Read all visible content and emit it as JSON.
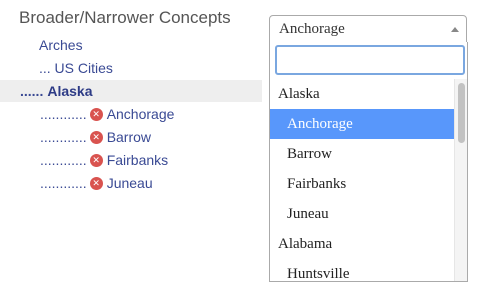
{
  "heading": "Broader/Narrower Concepts",
  "tree": {
    "root": "Arches",
    "parent": "... US Cities",
    "selected_prefix": "......",
    "selected": "Alaska",
    "child_prefix": "............",
    "children": [
      "Anchorage",
      "Barrow",
      "Fairbanks",
      "Juneau"
    ]
  },
  "select": {
    "value": "Anchorage",
    "search_value": "",
    "options": [
      {
        "label": "Alaska",
        "kind": "group"
      },
      {
        "label": "Anchorage",
        "kind": "child",
        "highlighted": true
      },
      {
        "label": "Barrow",
        "kind": "child"
      },
      {
        "label": "Fairbanks",
        "kind": "child"
      },
      {
        "label": "Juneau",
        "kind": "child"
      },
      {
        "label": "Alabama",
        "kind": "group"
      },
      {
        "label": "Huntsville",
        "kind": "child"
      }
    ]
  },
  "colors": {
    "link": "#3a4a94",
    "remove_icon": "#d9534f",
    "highlight": "#5897fb",
    "search_border": "#7aa7e0"
  },
  "icons": {
    "remove": "remove-circle-icon",
    "dropdown": "caret-up-icon"
  }
}
